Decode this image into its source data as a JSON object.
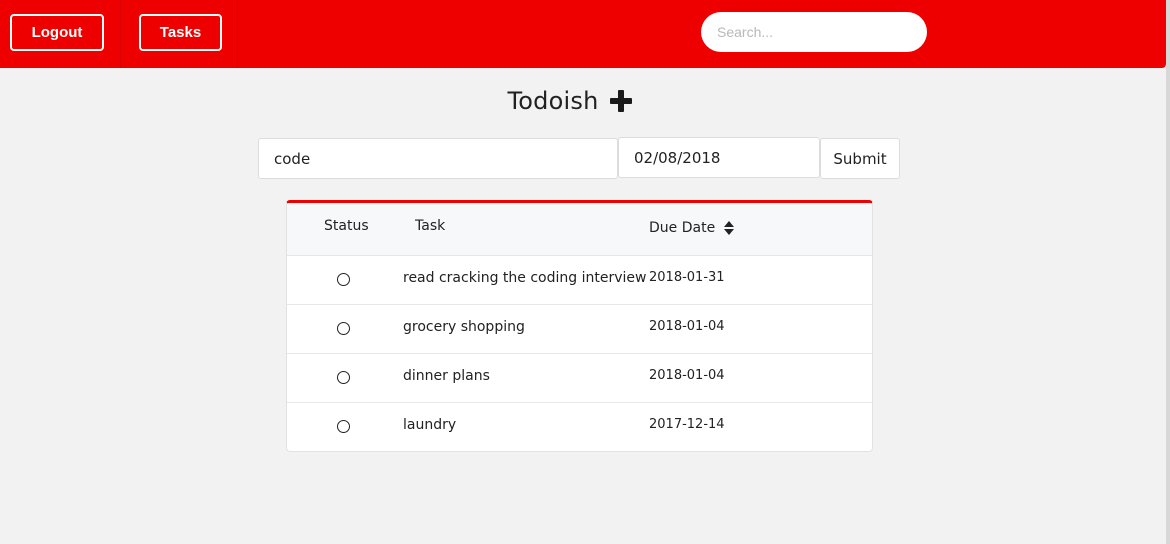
{
  "navbar": {
    "logout_label": "Logout",
    "tasks_label": "Tasks",
    "search_placeholder": "Search...",
    "accent_color": "#ee0000"
  },
  "header": {
    "title": "Todoish",
    "add_icon": "plus-icon"
  },
  "form": {
    "task_value": "code",
    "date_value": "02/08/2018",
    "submit_label": "Submit"
  },
  "table": {
    "columns": {
      "status": "Status",
      "task": "Task",
      "due_date": "Due Date"
    },
    "sort_icon": "sort-icon",
    "rows": [
      {
        "status": "incomplete",
        "task": "read cracking the coding interview",
        "due": "2018-01-31"
      },
      {
        "status": "incomplete",
        "task": "grocery shopping",
        "due": "2018-01-04"
      },
      {
        "status": "incomplete",
        "task": "dinner plans",
        "due": "2018-01-04"
      },
      {
        "status": "incomplete",
        "task": "laundry",
        "due": "2017-12-14"
      }
    ]
  }
}
